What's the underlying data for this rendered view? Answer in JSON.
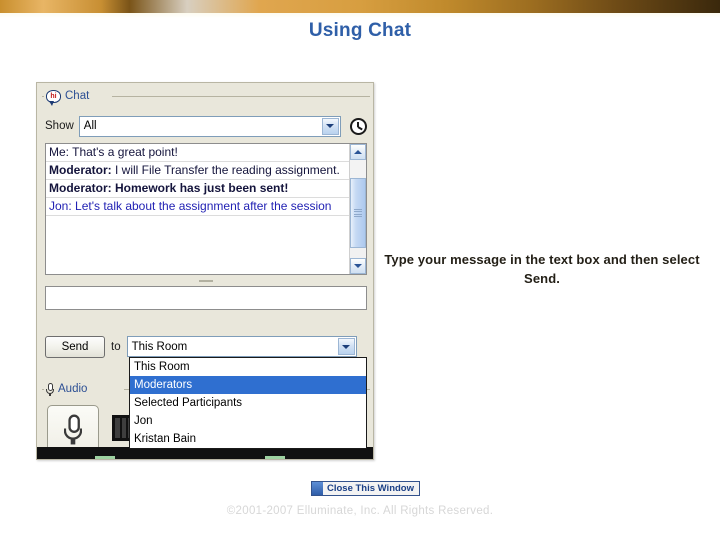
{
  "slide": {
    "title": "Using Chat",
    "title_color": "#2f5fa8",
    "instruction": "Type your message in the text box and then select Send.",
    "close_button_label": "Close This Window",
    "copyright": "©2001-2007 Elluminate, Inc. All Rights Reserved."
  },
  "chat_panel": {
    "group_label": "Chat",
    "group_icon": "hi-speech-bubble-icon",
    "hi_text": "hi",
    "show_label": "Show",
    "show_value": "All",
    "history_icon": "clock-icon",
    "transcript": [
      {
        "speaker": "Me:",
        "text": " That's a great point!",
        "style": "navy",
        "who_bold": false,
        "all_bold": false
      },
      {
        "speaker": "Moderator:",
        "text": " I will File Transfer the reading assignment.",
        "style": "navy",
        "who_bold": true,
        "all_bold": false
      },
      {
        "speaker": "Moderator:",
        "text": " Homework has just been sent!",
        "style": "navy",
        "who_bold": true,
        "all_bold": true
      },
      {
        "speaker": "Jon:",
        "text": " Let's talk about the assignment after the session",
        "style": "blue",
        "who_bold": false,
        "all_bold": false
      }
    ],
    "message_input_value": "",
    "message_input_placeholder": "",
    "send_label": "Send",
    "to_label": "to",
    "to_value": "This Room",
    "to_options": [
      {
        "label": "This Room",
        "selected": false
      },
      {
        "label": "Moderators",
        "selected": true
      },
      {
        "label": "Selected Participants",
        "selected": false
      },
      {
        "label": "Jon",
        "selected": false
      },
      {
        "label": "Kristan Bain",
        "selected": false
      }
    ],
    "audio_label": "Audio",
    "audio_icon": "microphone-icon",
    "talk_button_icon": "microphone-icon"
  },
  "colors": {
    "title_blue": "#2f5fa8",
    "panel_bg": "#e9e7db",
    "highlight_blue": "#2f6fd0",
    "chat_blue_text": "#2222b4",
    "banner_gold": "#d79e40"
  }
}
